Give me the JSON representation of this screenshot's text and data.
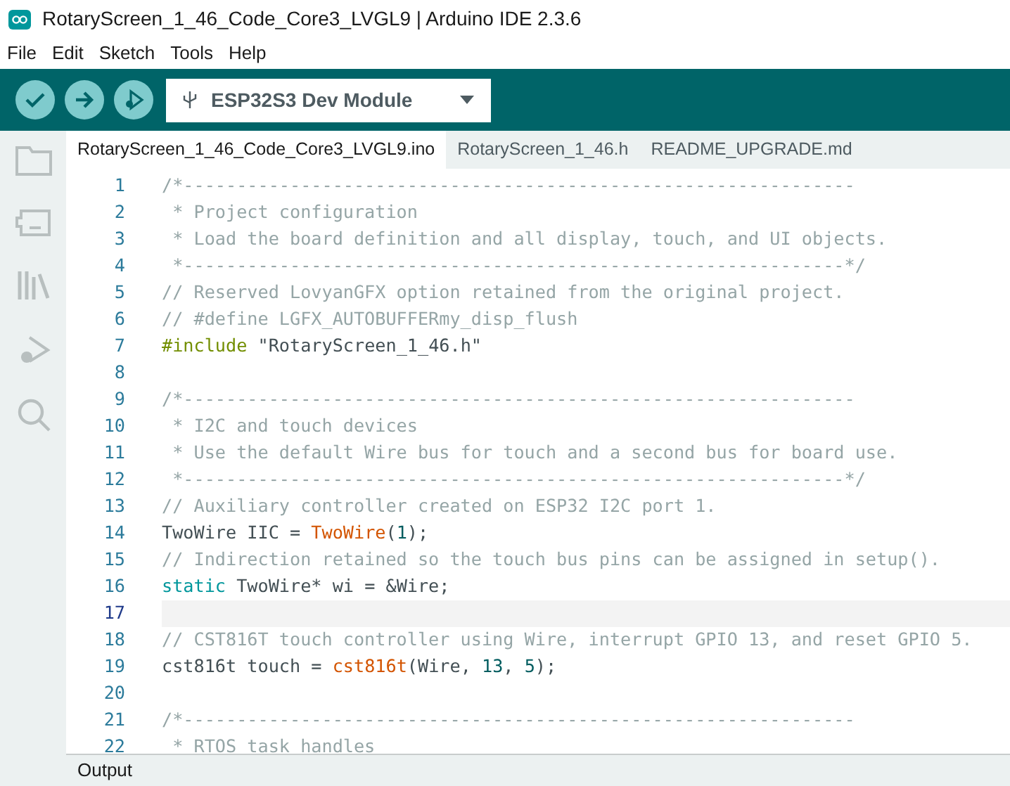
{
  "window": {
    "title": "RotaryScreen_1_46_Code_Core3_LVGL9 | Arduino IDE 2.3.6"
  },
  "menu": [
    "File",
    "Edit",
    "Sketch",
    "Tools",
    "Help"
  ],
  "toolbar": {
    "board": "ESP32S3 Dev Module"
  },
  "tabs": [
    {
      "label": "RotaryScreen_1_46_Code_Core3_LVGL9.ino",
      "selected": true
    },
    {
      "label": "RotaryScreen_1_46.h",
      "selected": false
    },
    {
      "label": "README_UPGRADE.md",
      "selected": false
    }
  ],
  "editor": {
    "lines": [
      {
        "number": "1",
        "current": false,
        "tokens": [
          {
            "kind": "comment",
            "text": "/*---------------------------------------------------------------"
          }
        ]
      },
      {
        "number": "2",
        "current": false,
        "tokens": [
          {
            "kind": "comment",
            "text": " * Project configuration"
          }
        ]
      },
      {
        "number": "3",
        "current": false,
        "tokens": [
          {
            "kind": "comment",
            "text": " * Load the board definition and all display, touch, and UI objects."
          }
        ]
      },
      {
        "number": "4",
        "current": false,
        "tokens": [
          {
            "kind": "comment",
            "text": " *--------------------------------------------------------------*/"
          }
        ]
      },
      {
        "number": "5",
        "current": false,
        "tokens": [
          {
            "kind": "comment",
            "text": "// Reserved LovyanGFX option retained from the original project."
          }
        ]
      },
      {
        "number": "6",
        "current": false,
        "tokens": [
          {
            "kind": "comment",
            "text": "// #define LGFX_AUTOBUFFERmy_disp_flush"
          }
        ]
      },
      {
        "number": "7",
        "current": false,
        "tokens": [
          {
            "kind": "directive",
            "text": "#include"
          },
          {
            "kind": "plain",
            "text": " \"RotaryScreen_1_46.h\""
          }
        ]
      },
      {
        "number": "8",
        "current": false
      },
      {
        "number": "9",
        "current": false,
        "tokens": [
          {
            "kind": "comment",
            "text": "/*---------------------------------------------------------------"
          }
        ]
      },
      {
        "number": "10",
        "current": false,
        "tokens": [
          {
            "kind": "comment",
            "text": " * I2C and touch devices"
          }
        ]
      },
      {
        "number": "11",
        "current": false,
        "tokens": [
          {
            "kind": "comment",
            "text": " * Use the default Wire bus for touch and a second bus for board use."
          }
        ]
      },
      {
        "number": "12",
        "current": false,
        "tokens": [
          {
            "kind": "comment",
            "text": " *--------------------------------------------------------------*/"
          }
        ]
      },
      {
        "number": "13",
        "current": false,
        "tokens": [
          {
            "kind": "comment",
            "text": "// Auxiliary controller created on ESP32 I2C port 1."
          }
        ]
      },
      {
        "number": "14",
        "current": false,
        "tokens": [
          {
            "kind": "plain",
            "text": "TwoWire IIC = "
          },
          {
            "kind": "function",
            "text": "TwoWire"
          },
          {
            "kind": "plain",
            "text": "("
          },
          {
            "kind": "number",
            "text": "1"
          },
          {
            "kind": "plain",
            "text": ");"
          }
        ]
      },
      {
        "number": "15",
        "current": false,
        "tokens": [
          {
            "kind": "comment",
            "text": "// Indirection retained so the touch bus pins can be assigned in setup()."
          }
        ]
      },
      {
        "number": "16",
        "current": false,
        "tokens": [
          {
            "kind": "keyword",
            "text": "static"
          },
          {
            "kind": "plain",
            "text": " TwoWire* wi = &Wire;"
          }
        ]
      },
      {
        "number": "17",
        "current": true
      },
      {
        "number": "18",
        "current": false,
        "tokens": [
          {
            "kind": "comment",
            "text": "// CST816T touch controller using Wire, interrupt GPIO 13, and reset GPIO 5."
          }
        ]
      },
      {
        "number": "19",
        "current": false,
        "tokens": [
          {
            "kind": "plain",
            "text": "cst816t touch = "
          },
          {
            "kind": "function",
            "text": "cst816t"
          },
          {
            "kind": "plain",
            "text": "(Wire, "
          },
          {
            "kind": "number",
            "text": "13"
          },
          {
            "kind": "plain",
            "text": ", "
          },
          {
            "kind": "number",
            "text": "5"
          },
          {
            "kind": "plain",
            "text": ");"
          }
        ]
      },
      {
        "number": "20",
        "current": false
      },
      {
        "number": "21",
        "current": false,
        "tokens": [
          {
            "kind": "comment",
            "text": "/*---------------------------------------------------------------"
          }
        ]
      },
      {
        "number": "22",
        "current": false,
        "tokens": [
          {
            "kind": "comment",
            "text": " * RTOS task handles"
          }
        ]
      }
    ]
  },
  "bottom_panel": {
    "title": "Output"
  }
}
